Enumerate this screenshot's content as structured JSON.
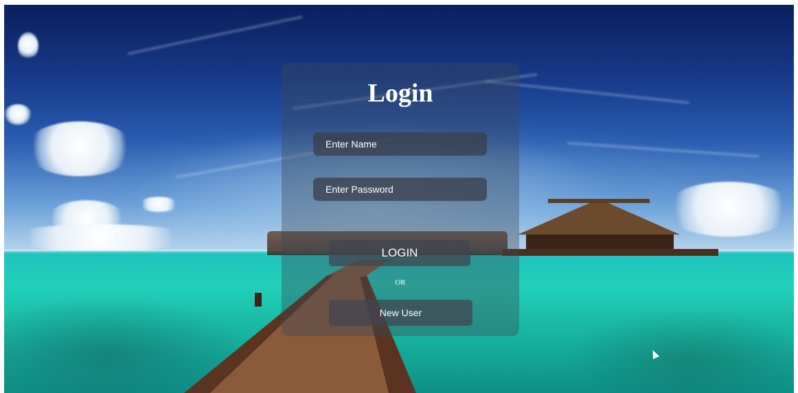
{
  "login_form": {
    "title": "Login",
    "name_placeholder": "Enter Name",
    "password_placeholder": "Enter Password",
    "login_button": "LOGIN",
    "separator": "OR",
    "new_user_button": "New User"
  },
  "colors": {
    "panel_background": "#3c4655",
    "field_background": "#373c46",
    "text": "#ffffff"
  }
}
